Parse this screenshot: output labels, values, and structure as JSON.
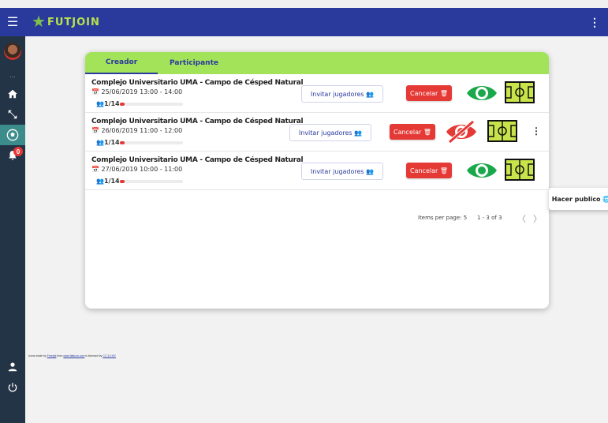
{
  "app": {
    "logo_text": "FUTJOIN",
    "accent": "#2a3a9c",
    "green": "#a3e35a"
  },
  "topbar": {
    "menu_icon": "menu-icon",
    "more_icon": "more-vert-icon"
  },
  "sidebar": {
    "dots": "...",
    "items": [
      {
        "name": "home-icon"
      },
      {
        "name": "tools-icon"
      },
      {
        "name": "soccer-ball-icon"
      },
      {
        "name": "bell-icon",
        "badge": "0"
      },
      {
        "name": "user-icon"
      },
      {
        "name": "power-icon"
      }
    ]
  },
  "tabs": [
    {
      "label": "Creador",
      "active": true
    },
    {
      "label": "Participante",
      "active": false
    }
  ],
  "matches": [
    {
      "title": "Complejo Universitario UMA - Campo de Césped Natural",
      "date": "📅 25/06/2019 13:00 - 14:00",
      "players": "👥1/14",
      "progress": 0.07,
      "invite_label": "Invitar jugadores 👥",
      "cancel_label": "Cancelar 🗑",
      "visible": true
    },
    {
      "title": "Complejo Universitario UMA - Campo de Césped Natural",
      "date": "📅 26/06/2019 11:00 - 12:00",
      "players": "👥1/14",
      "progress": 0.07,
      "invite_label": "Invitar jugadores 👥",
      "cancel_label": "Cancelar 🗑",
      "visible": false
    },
    {
      "title": "Complejo Universitario UMA - Campo de Césped Natural",
      "date": "📅 27/06/2019 10:00 - 11:00",
      "players": "👥1/14",
      "progress": 0.07,
      "invite_label": "Invitar jugadores 👥",
      "cancel_label": "Cancelar 🗑",
      "visible": true
    }
  ],
  "paginator": {
    "items_per_page": "Items per page: 5",
    "range": "1 - 3 of 3",
    "prev": "〈",
    "next": "〉"
  },
  "popup": {
    "label": "Hacer publico 🌐"
  },
  "credits": {
    "prefix": "Icons made by ",
    "author": "Freepik",
    "middle": " from ",
    "site": "www.flaticon.com",
    "suffix": " is licensed by ",
    "license": "CC 3.0 BY"
  }
}
